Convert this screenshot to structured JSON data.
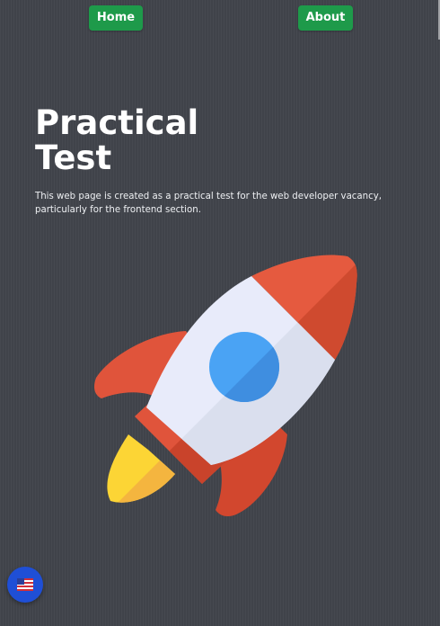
{
  "nav": {
    "home_label": "Home",
    "about_label": "About"
  },
  "hero": {
    "title_line1": "Practical",
    "title_line2": "Test",
    "description": "This web page is created as a practical test for the web developer vacancy, particularly for the frontend section."
  },
  "illustration": {
    "icon": "rocket-icon"
  },
  "language": {
    "icon": "us-flag-icon"
  },
  "colors": {
    "background": "#40434a",
    "nav_button": "#1e9a4a",
    "language_button": "#1f4fd6",
    "rocket_red": "#e0543b",
    "rocket_body": "#e6e9f5",
    "rocket_window": "#4aa3f4",
    "flame_yellow": "#fcd535"
  }
}
